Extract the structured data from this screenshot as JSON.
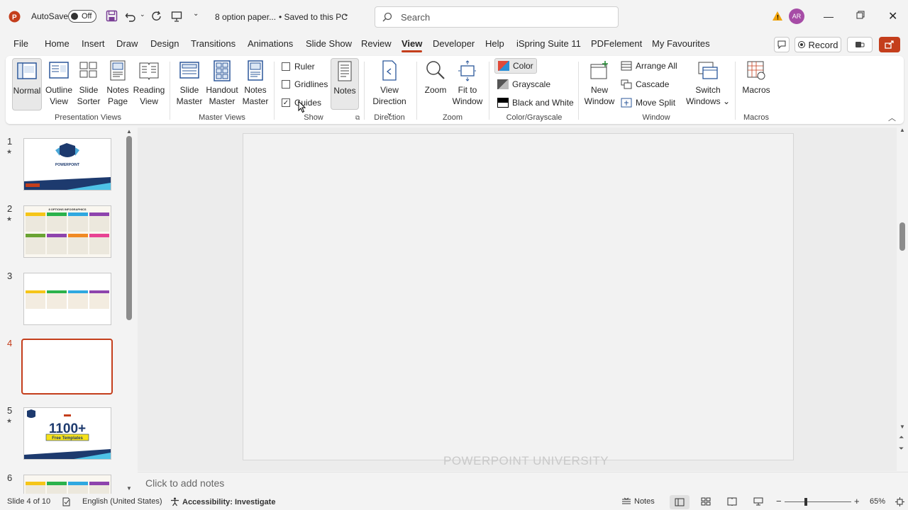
{
  "titlebar": {
    "autosave_label": "AutoSave",
    "toggle_label": "Off",
    "doc_title": "8 option paper...",
    "save_status": "• Saved to this PC",
    "search_placeholder": "Search",
    "avatar_initials": "AR"
  },
  "menu": {
    "tabs": [
      "File",
      "Home",
      "Insert",
      "Draw",
      "Design",
      "Transitions",
      "Animations",
      "Slide Show",
      "Review",
      "View",
      "Developer",
      "Help",
      "iSpring Suite 11",
      "PDFelement",
      "My Favourites"
    ],
    "active_tab": "View",
    "record_label": "Record"
  },
  "ribbon": {
    "presentation_views": {
      "label": "Presentation Views",
      "normal": "Normal",
      "outline_view": [
        "Outline",
        "View"
      ],
      "slide_sorter": [
        "Slide",
        "Sorter"
      ],
      "notes_page": [
        "Notes",
        "Page"
      ],
      "reading_view": [
        "Reading",
        "View"
      ]
    },
    "master_views": {
      "label": "Master Views",
      "slide_master": [
        "Slide",
        "Master"
      ],
      "handout_master": [
        "Handout",
        "Master"
      ],
      "notes_master": [
        "Notes",
        "Master"
      ]
    },
    "show": {
      "label": "Show",
      "ruler": "Ruler",
      "gridlines": "Gridlines",
      "guides": "Guides",
      "ruler_checked": false,
      "gridlines_checked": false,
      "guides_checked": true,
      "notes": "Notes"
    },
    "direction": {
      "label": "Direction",
      "view_direction": [
        "View",
        "Direction"
      ]
    },
    "zoom": {
      "label": "Zoom",
      "zoom": "Zoom",
      "fit_to_window": [
        "Fit to",
        "Window"
      ]
    },
    "color_grayscale": {
      "label": "Color/Grayscale",
      "color": "Color",
      "grayscale": "Grayscale",
      "black_and_white": "Black and White"
    },
    "window": {
      "label": "Window",
      "new_window": [
        "New",
        "Window"
      ],
      "arrange_all": "Arrange All",
      "cascade": "Cascade",
      "move_split": "Move Split",
      "switch_windows": [
        "Switch",
        "Windows"
      ]
    },
    "macros": {
      "label": "Macros",
      "macros": "Macros"
    }
  },
  "slides": {
    "numbers": [
      "1",
      "2",
      "3",
      "4",
      "5",
      "6"
    ],
    "selected": "4",
    "thumb1_title": "POWERPOINT",
    "thumb2_title": "8 OPTIONS INFOGRAPHICS",
    "thumb5_big": "1100+",
    "thumb5_sub": "Free Templates"
  },
  "canvas": {
    "notes_placeholder": "Click to add notes",
    "watermark": "POWERPOINT UNIVERSITY"
  },
  "statusbar": {
    "slide_info": "Slide 4 of 10",
    "language": "English (United States)",
    "accessibility": "Accessibility: Investigate",
    "notes": "Notes",
    "zoom_level": "65%"
  },
  "colors": {
    "accent": "#c43e1c",
    "ribbon_icon": "#2b579a"
  }
}
